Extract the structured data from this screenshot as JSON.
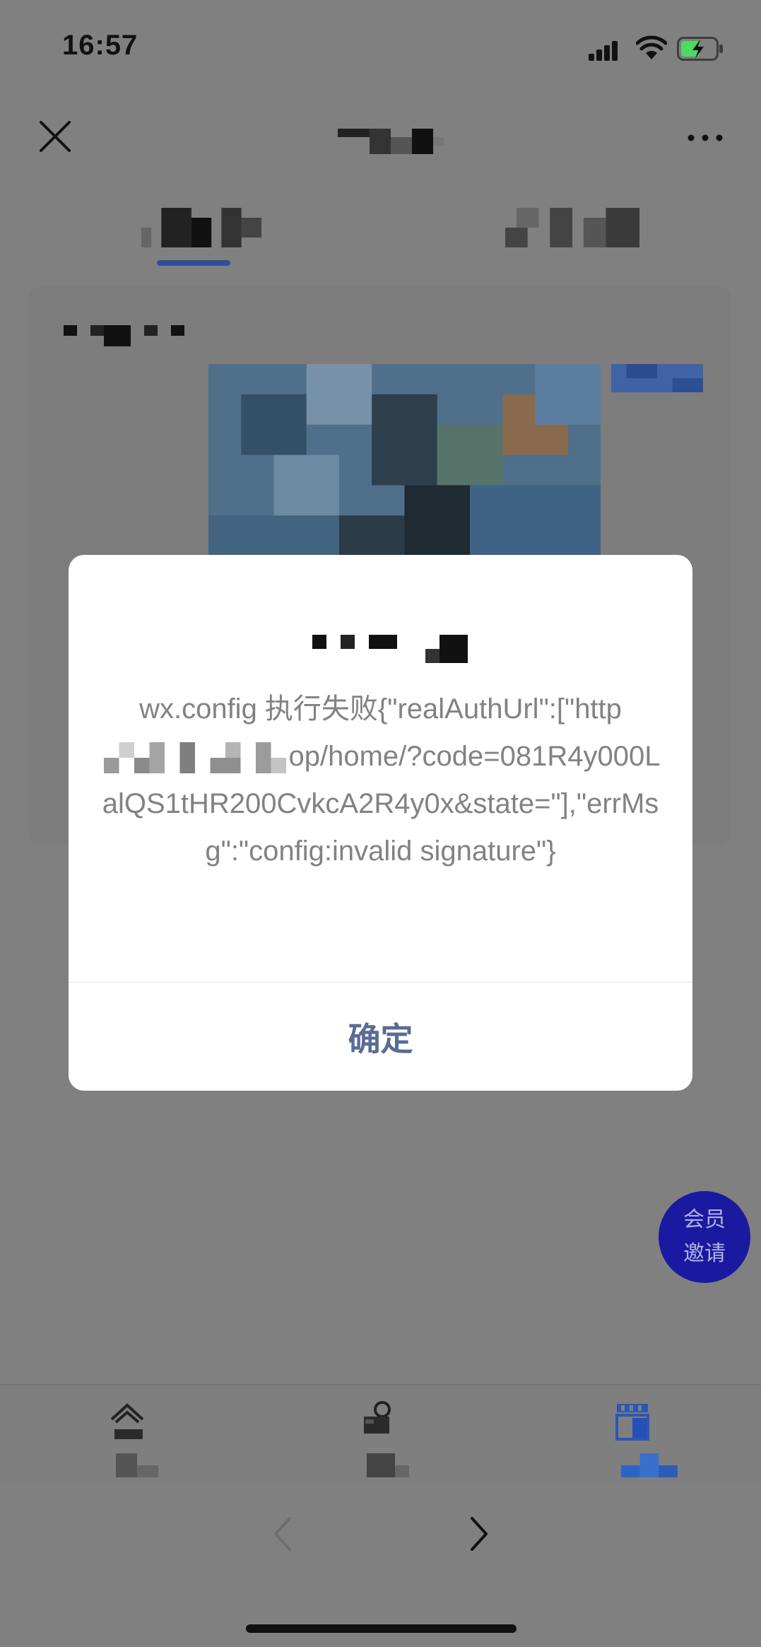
{
  "status_bar": {
    "time": "16:57"
  },
  "icons": {
    "close": "close-icon",
    "more": "more-icon",
    "back": "chevron-left-icon",
    "forward": "chevron-right-icon"
  },
  "dialog": {
    "message_part_1": "wx.config 执行失败{\"realAuthUrl\":[\"http",
    "message_part_2": "op/home/?code=081R4y000LalQS1tHR200CvkcA2R4y0x&state=\"],\"errMsg\":\"config:invalid signature\"}",
    "confirm_label": "确定"
  },
  "invite_button": {
    "line1": "会员",
    "line2": "邀请"
  },
  "colors": {
    "dialog_button_text": "#5a6c93",
    "invite_button_bg": "#1a1aa0",
    "tab_underline": "#2d4f9a",
    "overlay": "#808080"
  }
}
